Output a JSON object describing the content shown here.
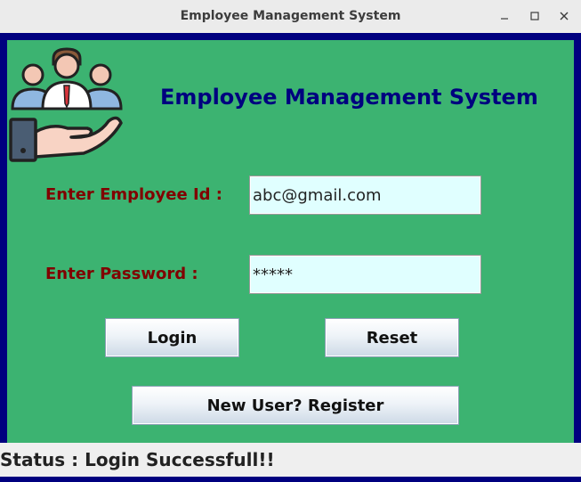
{
  "window": {
    "title": "Employee Management System"
  },
  "header": {
    "heading": "Employee Management System",
    "logo_icon": "employees-in-hand-icon"
  },
  "form": {
    "employee_id_label": "Enter Employee Id :",
    "employee_id_value": "abc@gmail.com",
    "password_label": "Enter Password :",
    "password_value": "*****"
  },
  "buttons": {
    "login": "Login",
    "reset": "Reset",
    "register": "New User? Register"
  },
  "status": {
    "text": "Status : Login Successfull!!"
  },
  "colors": {
    "panel": "#3cb371",
    "frame": "#00007f",
    "heading": "#00007f",
    "label": "#800000",
    "field_bg": "#e0ffff"
  }
}
